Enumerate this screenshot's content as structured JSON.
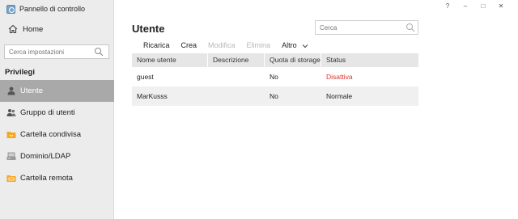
{
  "window": {
    "help_label": "?",
    "minimize_label": "–",
    "maximize_label": "□",
    "close_label": "✕"
  },
  "app": {
    "title": "Pannello di controllo",
    "home_label": "Home"
  },
  "sidebar": {
    "search_placeholder": "Cerca impostazioni",
    "section_title": "Privilegi",
    "items": [
      {
        "label": "Utente",
        "icon": "user-icon",
        "active": true
      },
      {
        "label": "Gruppo di utenti",
        "icon": "user-group-icon",
        "active": false
      },
      {
        "label": "Cartella condivisa",
        "icon": "shared-folder-icon",
        "active": false
      },
      {
        "label": "Dominio/LDAP",
        "icon": "domain-server-icon",
        "active": false
      },
      {
        "label": "Cartella remota",
        "icon": "remote-folder-icon",
        "active": false
      }
    ]
  },
  "main": {
    "title": "Utente",
    "search_placeholder": "Cerca",
    "toolbar": {
      "reload": "Ricarica",
      "create": "Crea",
      "edit": "Modifica",
      "delete": "Elimina",
      "more": "Altro"
    },
    "table": {
      "columns": [
        "Nome utente",
        "Descrizione",
        "Quota di storage",
        "Status"
      ],
      "rows": [
        {
          "name": "guest",
          "description": "",
          "quota": "No",
          "status": "Disattiva",
          "status_color": "#e0312b"
        },
        {
          "name": "MarKusss",
          "description": "",
          "quota": "No",
          "status": "Normale",
          "status_color": "#222222"
        }
      ]
    }
  },
  "colors": {
    "sidebar_bg": "#ececec",
    "active_item_bg": "#a9a9a9",
    "header_bg": "#e6e6e6",
    "alt_row_bg": "#f0f0f0",
    "inactive_status": "#e0312b",
    "folder_orange": "#f5a623"
  }
}
